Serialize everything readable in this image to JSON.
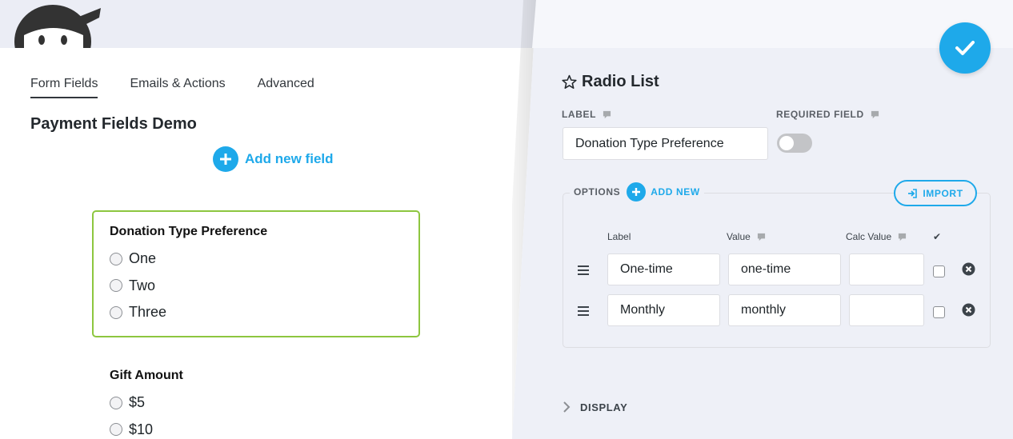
{
  "tabs": [
    {
      "label": "Form Fields",
      "active": true
    },
    {
      "label": "Emails & Actions",
      "active": false
    },
    {
      "label": "Advanced",
      "active": false
    }
  ],
  "form": {
    "title": "Payment Fields Demo",
    "add_field_label": "Add new field"
  },
  "fields": [
    {
      "label": "Donation Type Preference",
      "options": [
        "One",
        "Two",
        "Three"
      ],
      "selected": true
    },
    {
      "label": "Gift Amount",
      "options": [
        "$5",
        "$10"
      ],
      "selected": false
    }
  ],
  "drawer": {
    "title": "Radio List",
    "label_heading": "LABEL",
    "label_value": "Donation Type Preference",
    "required_heading": "REQUIRED FIELD",
    "required_on": false,
    "options_heading": "OPTIONS",
    "add_new_label": "ADD NEW",
    "import_label": "IMPORT",
    "columns": {
      "label": "Label",
      "value": "Value",
      "calc": "Calc Value",
      "selected": "✔"
    },
    "options": [
      {
        "label": "One-time",
        "value": "one-time",
        "calc": "",
        "checked": false
      },
      {
        "label": "Monthly",
        "value": "monthly",
        "calc": "",
        "checked": false
      }
    ],
    "display_heading": "DISPLAY"
  },
  "colors": {
    "accent": "#1ea9ea",
    "selected_border": "#8dc63f",
    "drawer_bg": "#eef0f7",
    "top_band": "#ebedf5"
  },
  "icons": {
    "done": "check-icon",
    "title": "star-outline-icon",
    "tip": "speech-bubble-icon",
    "add": "plus-icon",
    "import": "sign-in-icon",
    "drag": "hamburger-icon",
    "remove": "close-circle-icon",
    "expand": "chevron-right-icon"
  }
}
